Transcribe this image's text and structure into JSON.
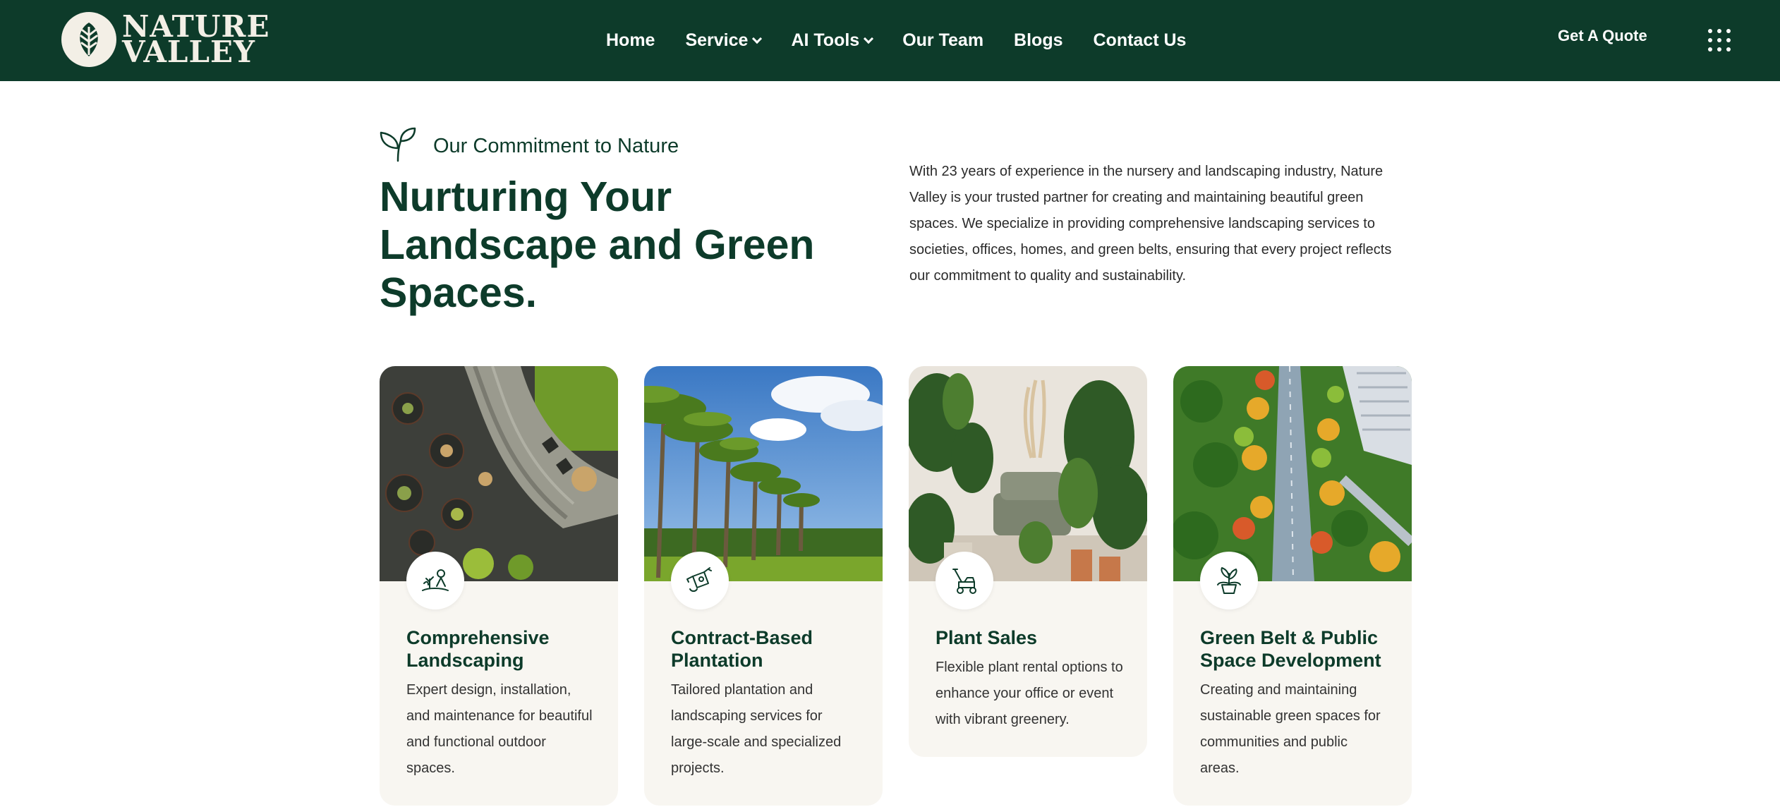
{
  "brand": {
    "line1": "NATURE",
    "line2": "VALLEY"
  },
  "nav": {
    "items": [
      {
        "label": "Home",
        "dropdown": false
      },
      {
        "label": "Service",
        "dropdown": true
      },
      {
        "label": "AI Tools",
        "dropdown": true
      },
      {
        "label": "Our Team",
        "dropdown": false
      },
      {
        "label": "Blogs",
        "dropdown": false
      },
      {
        "label": "Contact Us",
        "dropdown": false
      }
    ],
    "cta": "Get A Quote",
    "menu_icon": "grid-dots-icon"
  },
  "intro": {
    "eyebrow": "Our Commitment to Nature",
    "heading": "Nurturing Your Landscape and Green Spaces.",
    "paragraph": "With 23 years of experience in the nursery and landscaping industry, Nature Valley is your trusted partner for creating and maintaining beautiful green spaces. We specialize in providing comprehensive landscaping services to societies, offices, homes, and green belts, ensuring that every project reflects our commitment to quality and sustainability."
  },
  "services": [
    {
      "title": "Comprehensive Landscaping",
      "desc": "Expert design, installation, and maintenance for beautiful and functional outdoor spaces.",
      "icon": "landscaping-icon"
    },
    {
      "title": "Contract-Based Plantation",
      "desc": "Tailored plantation and landscaping services for large-scale and specialized projects.",
      "icon": "watering-can-icon"
    },
    {
      "title": "Plant Sales",
      "desc": "Flexible plant rental options to enhance your office or event with vibrant greenery.",
      "icon": "lawn-mower-icon"
    },
    {
      "title": "Green Belt & Public Space Development",
      "desc": "Creating and maintaining sustainable green spaces for communities and public areas.",
      "icon": "potted-plant-icon"
    }
  ],
  "colors": {
    "primary": "#0d3b2a",
    "card_bg": "#f8f6f1",
    "logo_cream": "#f3efe6"
  }
}
